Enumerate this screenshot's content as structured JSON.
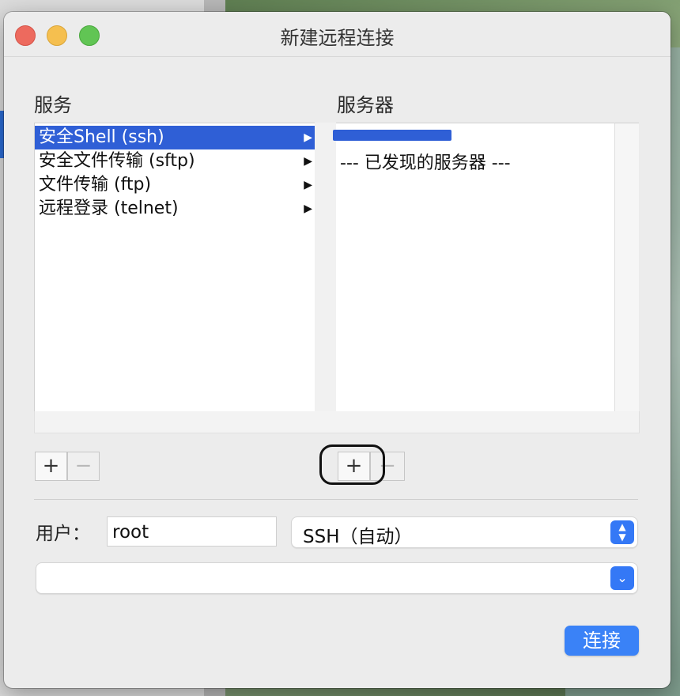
{
  "window": {
    "title": "新建远程连接"
  },
  "services": {
    "label": "服务",
    "items": [
      {
        "label": "安全Shell (ssh)",
        "selected": true
      },
      {
        "label": "安全文件传输 (sftp)",
        "selected": false
      },
      {
        "label": "文件传输 (ftp)",
        "selected": false
      },
      {
        "label": "远程登录 (telnet)",
        "selected": false
      }
    ],
    "add_label": "+",
    "remove_label": "−"
  },
  "servers": {
    "label": "服务器",
    "discovered_header": "--- 已发现的服务器 ---",
    "add_label": "+",
    "remove_label": "−"
  },
  "user": {
    "label": "用户：",
    "value": "root"
  },
  "protocol": {
    "selected": "SSH（自动）"
  },
  "host": {
    "value": ""
  },
  "connect_button": "连接",
  "colors": {
    "selection": "#2f5fd6",
    "accent": "#3a82f7"
  }
}
